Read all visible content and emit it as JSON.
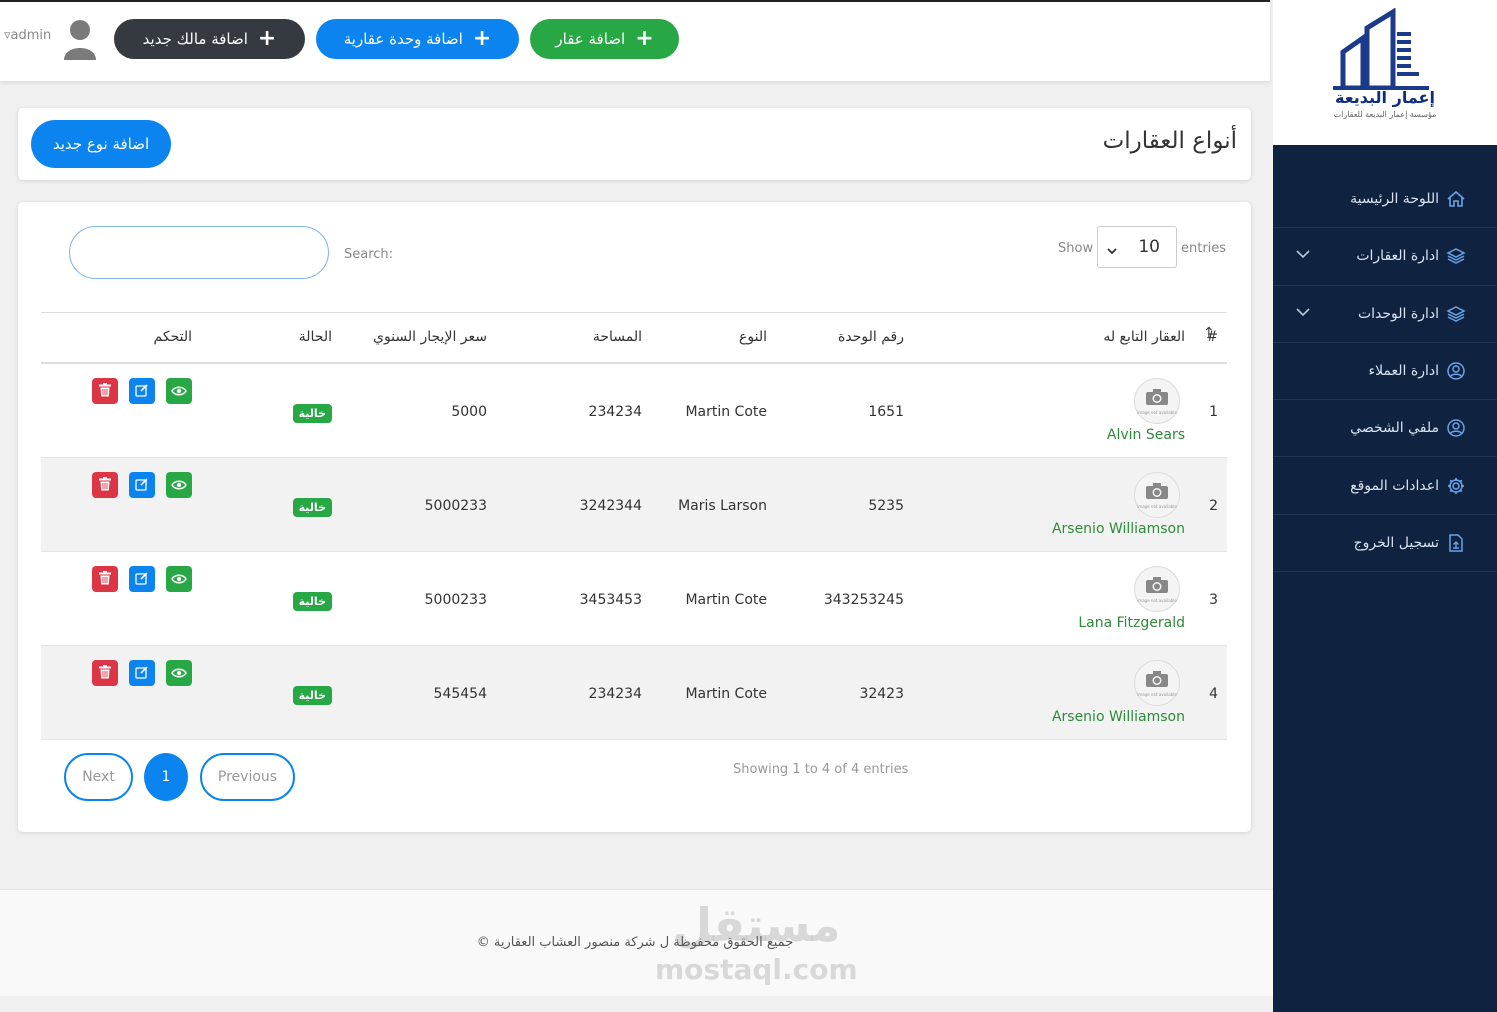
{
  "sidebar": {
    "logo_title": "إعمار البديعة",
    "logo_subtitle": "مؤسسة إعمار البديعة للعقارات",
    "items": [
      {
        "label": "اللوحة الرئيسية",
        "icon": "home-icon"
      },
      {
        "label": "ادارة العقارات",
        "icon": "layers-icon"
      },
      {
        "label": "ادارة الوحدات",
        "icon": "layers-icon"
      },
      {
        "label": "ادارة العملاء",
        "icon": "user-circle-icon"
      },
      {
        "label": "ملفي الشخصي",
        "icon": "user-circle-icon"
      },
      {
        "label": "اعدادات الموقع",
        "icon": "gear-icon"
      },
      {
        "label": "تسجيل الخروج",
        "icon": "file-export-icon"
      }
    ]
  },
  "topbar": {
    "add_property": "اضافة عقار",
    "add_unit": "اضافة وحدة عقارية",
    "add_owner": "اضافة مالك جديد",
    "user": "admin"
  },
  "header": {
    "title": "أنواع العقارات",
    "add_type": "اضافة نوع جديد"
  },
  "table": {
    "show": "Show",
    "entries_value": "10",
    "entries": "entries",
    "search": "Search:",
    "columns": {
      "num": "#",
      "property": "العقار التابع له",
      "unit": "رقم الوحدة",
      "type": "النوع",
      "area": "المساحة",
      "rent": "سعر الإيجار السنوي",
      "status": "الحالة",
      "control": "التحكم"
    },
    "image_placeholder": "image not available",
    "rows": [
      {
        "num": "1",
        "owner": "Alvin Sears",
        "unit": "1651",
        "type": "Martin Cote",
        "area": "234234",
        "rent": "5000",
        "status": "خالية"
      },
      {
        "num": "2",
        "owner": "Arsenio Williamson",
        "unit": "5235",
        "type": "Maris Larson",
        "area": "3242344",
        "rent": "5000233",
        "status": "خالية"
      },
      {
        "num": "3",
        "owner": "Lana Fitzgerald",
        "unit": "343253245",
        "type": "Martin Cote",
        "area": "3453453",
        "rent": "5000233",
        "status": "خالية"
      },
      {
        "num": "4",
        "owner": "Arsenio Williamson",
        "unit": "32423",
        "type": "Martin Cote",
        "area": "234234",
        "rent": "545454",
        "status": "خالية"
      }
    ],
    "showing": "Showing 1 to 4 of 4 entries",
    "pagination": {
      "next": "Next",
      "page": "1",
      "previous": "Previous"
    }
  },
  "footer": {
    "text": "جميع الحقوق محفوظة ل شركة منصور العشاب العقارية ©",
    "watermark_ar": "مستقل",
    "watermark_en": "mostaql.com"
  },
  "colors": {
    "sidebar": "#0f2340",
    "primary": "#0b84f0",
    "success": "#28a745",
    "dark": "#343a40",
    "danger": "#dc3545"
  }
}
